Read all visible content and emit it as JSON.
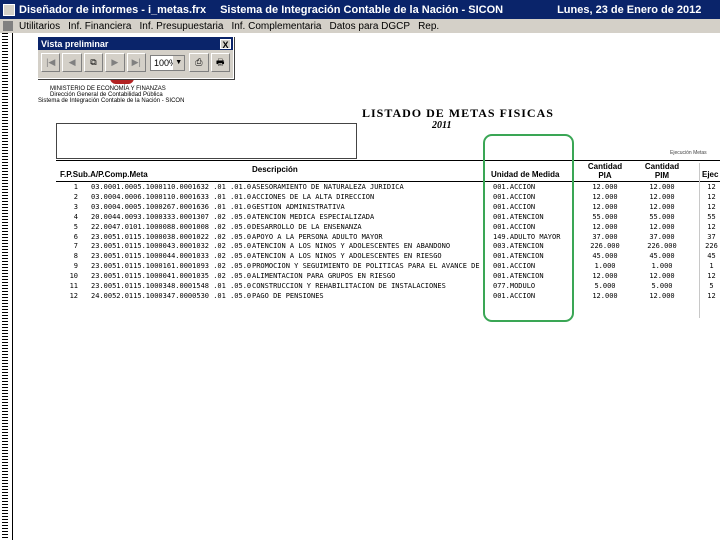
{
  "window": {
    "title_app": "Diseñador de informes - i_metas.frx",
    "title_system": "Sistema de Integración Contable de la Nación - SICON",
    "title_date": "Lunes, 23 de Enero de 2012"
  },
  "menu": [
    "Utilitarios",
    "Inf. Financiera",
    "Inf. Presupuestaria",
    "Inf. Complementaria",
    "Datos para DGCP",
    "Rep."
  ],
  "preview": {
    "title": "Vista preliminar",
    "close_label": "X",
    "zoom": "100%",
    "buttons": [
      "first-page-icon",
      "prev-page-icon",
      "goto-page-icon",
      "next-page-icon",
      "last-page-icon",
      "zoom-select",
      "print-setup-icon",
      "print-icon"
    ]
  },
  "report": {
    "ministry_lines": [
      "MINISTERIO DE ECONOMÍA Y FINANZAS",
      "Dirección General de Contabilidad Pública",
      "Sistema de Integración Contable de la Nación - SICON"
    ],
    "title": "LISTADO DE METAS FISICAS",
    "year": "2011",
    "header_right": "Ejecución Metas",
    "columns": {
      "codes": "F.P.Sub.A/P.Comp.Meta",
      "description": "Descripción",
      "unit": "Unidad de Medida",
      "qty_pia": "Cantidad PIA",
      "qty_pim": "Cantidad PIM",
      "exec": "Ejec"
    },
    "rows": [
      {
        "n": "1",
        "codes": "03.0001.0005.1000110.0001632 .01 .01.00001",
        "desc": "ASESORAMIENTO DE NATURALEZA JURIDICA",
        "unit": "001.ACCION",
        "pia": "12.000",
        "pim": "12.000",
        "ej": "12"
      },
      {
        "n": "2",
        "codes": "03.0004.0006.1000110.0001633 .01 .01.00001",
        "desc": "ACCIONES DE LA ALTA DIRECCION",
        "unit": "001.ACCION",
        "pia": "12.000",
        "pim": "12.000",
        "ej": "12"
      },
      {
        "n": "3",
        "codes": "03.0004.0005.1000267.0001636 .01 .01.00001",
        "desc": "GESTION ADMINISTRATIVA",
        "unit": "001.ACCION",
        "pia": "12.000",
        "pim": "12.000",
        "ej": "12"
      },
      {
        "n": "4",
        "codes": "20.0044.0093.1000333.0001307 .02 .05.00001",
        "desc": "ATENCION MEDICA ESPECIALIZADA",
        "unit": "001.ATENCION",
        "pia": "55.000",
        "pim": "55.000",
        "ej": "55"
      },
      {
        "n": "5",
        "codes": "22.0047.0101.1000088.0001008 .02 .05.00001",
        "desc": "DESARROLLO DE LA ENSEÑANZA",
        "unit": "001.ACCION",
        "pia": "12.000",
        "pim": "12.000",
        "ej": "12"
      },
      {
        "n": "6",
        "codes": "23.0051.0115.1000038.0001022 .02 .05.00001",
        "desc": "APOYO A LA PERSONA ADULTO MAYOR",
        "unit": "149.ADULTO MAYOR",
        "pia": "37.000",
        "pim": "37.000",
        "ej": "37"
      },
      {
        "n": "7",
        "codes": "23.0051.0115.1000043.0001032 .02 .05.00001",
        "desc": "ATENCION A LOS NIÑOS Y ADOLESCENTES EN ABANDONO",
        "unit": "003.ATENCION",
        "pia": "226.000",
        "pim": "226.000",
        "ej": "226"
      },
      {
        "n": "8",
        "codes": "23.0051.0115.1000044.0001033 .02 .05.00001",
        "desc": "ATENCION A LOS NIÑOS Y ADOLESCENTES EN RIESGO",
        "unit": "001.ATENCION",
        "pia": "45.000",
        "pim": "45.000",
        "ej": "45"
      },
      {
        "n": "9",
        "codes": "23.0051.0115.1000161.0001093 .02 .05.00001",
        "desc": "PROMOCION Y SEGUIMIENTO DE POLITICAS PARA EL AVANCE DE",
        "unit": "001.ACCION",
        "pia": "1.000",
        "pim": "1.000",
        "ej": "1"
      },
      {
        "n": "10",
        "codes": "23.0051.0115.1000041.0001035 .02 .05.00001",
        "desc": "ALIMENTACION PARA GRUPOS EN RIESGO",
        "unit": "001.ATENCION",
        "pia": "12.000",
        "pim": "12.000",
        "ej": "12"
      },
      {
        "n": "11",
        "codes": "23.0051.0115.1000348.0001548 .01 .05.00001",
        "desc": "CONSTRUCCION Y REHABILITACION DE INSTALACIONES",
        "unit": "077.MODULO",
        "pia": "5.000",
        "pim": "5.000",
        "ej": "5"
      },
      {
        "n": "12",
        "codes": "24.0052.0115.1000347.0000530 .01 .05.00001",
        "desc": "PAGO DE PENSIONES",
        "unit": "001.ACCION",
        "pia": "12.000",
        "pim": "12.000",
        "ej": "12"
      }
    ]
  }
}
